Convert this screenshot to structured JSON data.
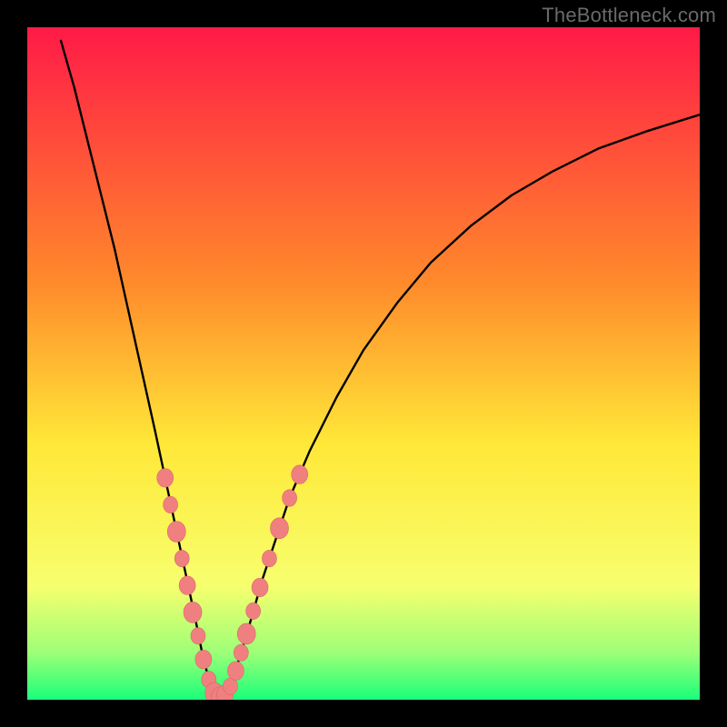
{
  "watermark": "TheBottleneck.com",
  "colors": {
    "frame": "#000000",
    "curve": "#000000",
    "dot_fill": "#f08080",
    "dot_stroke": "#d66868",
    "gradient_top": "#ff1a47",
    "gradient_mid1": "#ff8a2b",
    "gradient_mid2": "#ffe838",
    "gradient_mid3": "#f7ff6e",
    "gradient_mid4": "#9dff77",
    "gradient_bottom": "#1aff7a"
  },
  "chart_data": {
    "type": "line",
    "title": "",
    "xlabel": "",
    "ylabel": "",
    "xlim": [
      0,
      100
    ],
    "ylim": [
      0,
      100
    ],
    "grid": false,
    "curve": {
      "minimum_x": 28,
      "minimum_y": 0,
      "points": [
        {
          "x": 5.0,
          "y": 98.0
        },
        {
          "x": 7.0,
          "y": 91.0
        },
        {
          "x": 9.0,
          "y": 83.0
        },
        {
          "x": 11.0,
          "y": 75.0
        },
        {
          "x": 13.0,
          "y": 67.0
        },
        {
          "x": 15.0,
          "y": 58.0
        },
        {
          "x": 17.0,
          "y": 49.0
        },
        {
          "x": 19.0,
          "y": 40.0
        },
        {
          "x": 20.5,
          "y": 33.0
        },
        {
          "x": 22.0,
          "y": 26.0
        },
        {
          "x": 23.5,
          "y": 19.0
        },
        {
          "x": 25.0,
          "y": 12.0
        },
        {
          "x": 26.0,
          "y": 7.0
        },
        {
          "x": 27.0,
          "y": 3.0
        },
        {
          "x": 28.0,
          "y": 0.5
        },
        {
          "x": 29.0,
          "y": 0.5
        },
        {
          "x": 30.0,
          "y": 2.0
        },
        {
          "x": 31.5,
          "y": 6.0
        },
        {
          "x": 33.0,
          "y": 11.0
        },
        {
          "x": 35.0,
          "y": 18.0
        },
        {
          "x": 37.0,
          "y": 24.0
        },
        {
          "x": 39.0,
          "y": 30.0
        },
        {
          "x": 42.0,
          "y": 37.0
        },
        {
          "x": 46.0,
          "y": 45.0
        },
        {
          "x": 50.0,
          "y": 52.0
        },
        {
          "x": 55.0,
          "y": 59.0
        },
        {
          "x": 60.0,
          "y": 65.0
        },
        {
          "x": 66.0,
          "y": 70.5
        },
        {
          "x": 72.0,
          "y": 75.0
        },
        {
          "x": 78.0,
          "y": 78.5
        },
        {
          "x": 85.0,
          "y": 82.0
        },
        {
          "x": 92.0,
          "y": 84.5
        },
        {
          "x": 100.0,
          "y": 87.0
        }
      ]
    },
    "dots": [
      {
        "x": 20.5,
        "y": 33.0,
        "r": 9
      },
      {
        "x": 21.3,
        "y": 29.0,
        "r": 8
      },
      {
        "x": 22.2,
        "y": 25.0,
        "r": 10
      },
      {
        "x": 23.0,
        "y": 21.0,
        "r": 8
      },
      {
        "x": 23.8,
        "y": 17.0,
        "r": 9
      },
      {
        "x": 24.6,
        "y": 13.0,
        "r": 10
      },
      {
        "x": 25.4,
        "y": 9.5,
        "r": 8
      },
      {
        "x": 26.2,
        "y": 6.0,
        "r": 9
      },
      {
        "x": 27.0,
        "y": 3.0,
        "r": 8
      },
      {
        "x": 27.8,
        "y": 1.0,
        "r": 10
      },
      {
        "x": 28.6,
        "y": 0.5,
        "r": 9
      },
      {
        "x": 29.4,
        "y": 0.8,
        "r": 9
      },
      {
        "x": 30.2,
        "y": 2.0,
        "r": 8
      },
      {
        "x": 31.0,
        "y": 4.3,
        "r": 9
      },
      {
        "x": 31.8,
        "y": 7.0,
        "r": 8
      },
      {
        "x": 32.6,
        "y": 9.8,
        "r": 10
      },
      {
        "x": 33.6,
        "y": 13.2,
        "r": 8
      },
      {
        "x": 34.6,
        "y": 16.7,
        "r": 9
      },
      {
        "x": 36.0,
        "y": 21.0,
        "r": 8
      },
      {
        "x": 37.5,
        "y": 25.5,
        "r": 10
      },
      {
        "x": 39.0,
        "y": 30.0,
        "r": 8
      },
      {
        "x": 40.5,
        "y": 33.5,
        "r": 9
      }
    ]
  }
}
